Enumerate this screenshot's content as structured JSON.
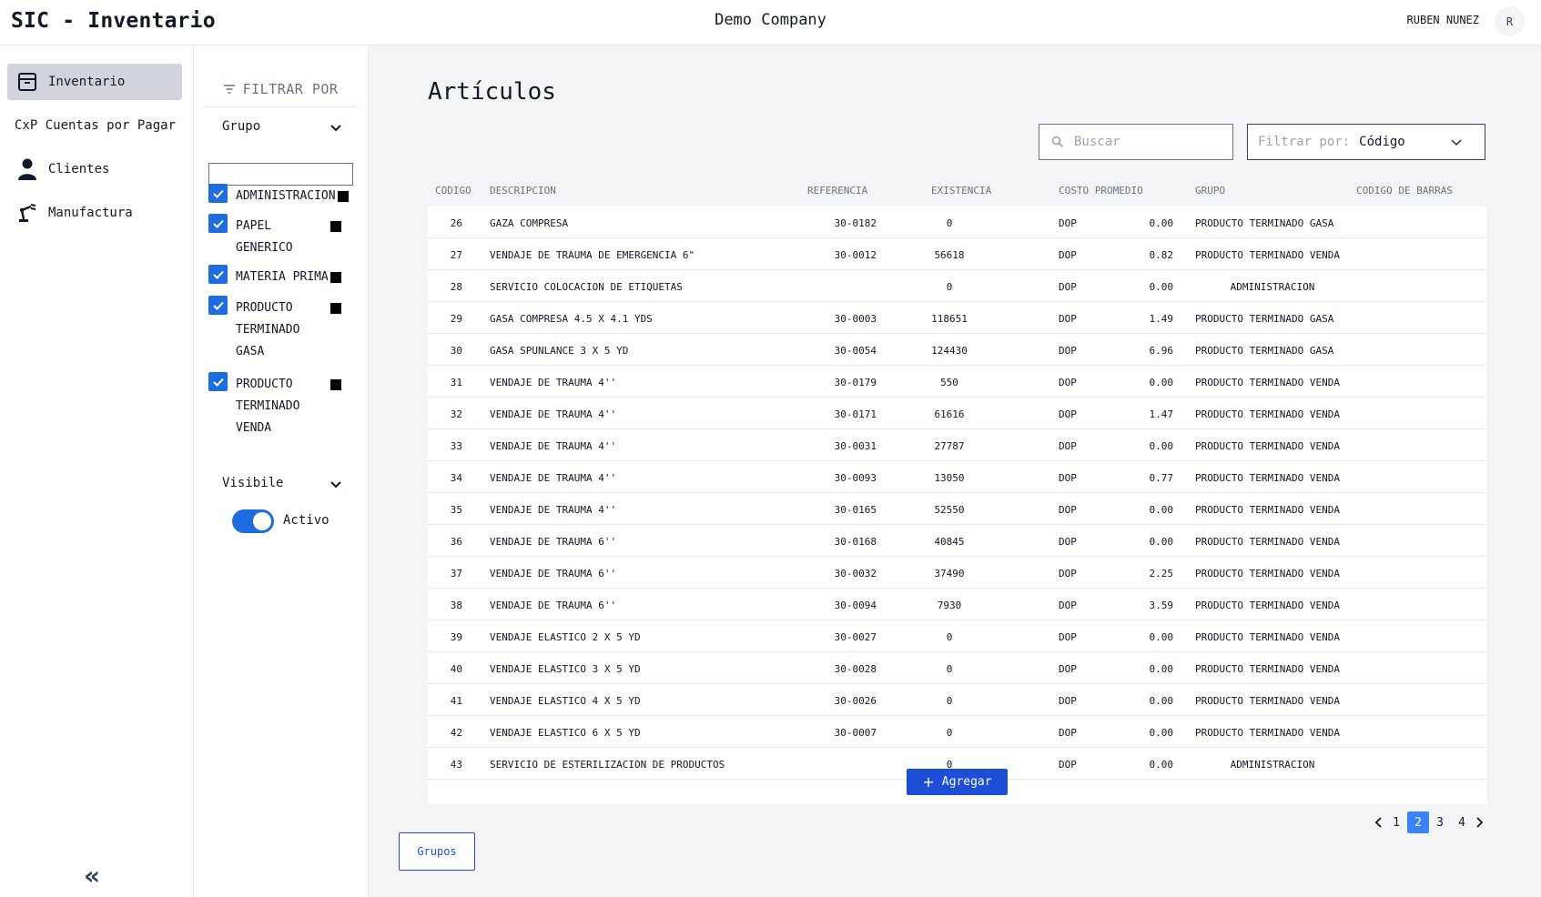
{
  "header": {
    "app_title": "SIC - Inventario",
    "company": "Demo Company",
    "user_name": "RUBEN NUNEZ",
    "avatar_initial": "R"
  },
  "sidebar": {
    "items": [
      {
        "label": "Inventario",
        "icon": "archive-box-icon",
        "active": true
      },
      {
        "label": "CxP Cuentas por Pagar",
        "icon": "",
        "active": false
      },
      {
        "label": "Clientes",
        "icon": "user-icon",
        "active": false
      },
      {
        "label": "Manufactura",
        "icon": "robot-arm-icon",
        "active": false
      }
    ],
    "collapse_glyph": "«"
  },
  "filters": {
    "heading": "FILTRAR POR",
    "group_section": "Grupo",
    "group_search_value": "",
    "groups": [
      {
        "label_lines": [
          "ADMINISTRACION"
        ],
        "checked": true
      },
      {
        "label_lines": [
          "PAPEL",
          "GENERICO"
        ],
        "checked": true
      },
      {
        "label_lines": [
          "MATERIA PRIMA"
        ],
        "checked": true
      },
      {
        "label_lines": [
          "PRODUCTO",
          "TERMINADO",
          "GASA"
        ],
        "checked": true
      },
      {
        "label_lines": [
          "PRODUCTO",
          "TERMINADO",
          "VENDA"
        ],
        "checked": true
      }
    ],
    "visible_section": "Visibile",
    "toggle_label": "Activo",
    "toggle_on": true
  },
  "main": {
    "title": "Artículos",
    "search_placeholder": "Buscar",
    "search_value": "",
    "filter_label": "Filtrar por:",
    "filter_value": "Código",
    "add_button": "Agregar",
    "groups_button": "Grupos",
    "pagination": {
      "pages": [
        "1",
        "2",
        "3",
        "4"
      ],
      "current": "2"
    }
  },
  "table": {
    "columns": [
      "CODIGO",
      "DESCRIPCION",
      "REFERENCIA",
      "EXISTENCIA",
      "COSTO PROMEDIO",
      "GRUPO",
      "CODIGO DE BARRAS"
    ],
    "rows": [
      {
        "codigo": "26",
        "descripcion": "GAZA COMPRESA",
        "referencia": "30-0182",
        "existencia": "0",
        "moneda": "DOP",
        "costo": "0.00",
        "grupo": "PRODUCTO TERMINADO GASA",
        "barras": ""
      },
      {
        "codigo": "27",
        "descripcion": "VENDAJE DE TRAUMA DE EMERGENCIA 6\"",
        "referencia": "30-0012",
        "existencia": "56618",
        "moneda": "DOP",
        "costo": "0.82",
        "grupo": "PRODUCTO TERMINADO VENDA",
        "barras": ""
      },
      {
        "codigo": "28",
        "descripcion": "SERVICIO COLOCACION DE ETIQUETAS",
        "referencia": "",
        "existencia": "0",
        "moneda": "DOP",
        "costo": "0.00",
        "grupo": "ADMINISTRACION",
        "barras": ""
      },
      {
        "codigo": "29",
        "descripcion": "GASA COMPRESA 4.5 X 4.1 YDS",
        "referencia": "30-0003",
        "existencia": "118651",
        "moneda": "DOP",
        "costo": "1.49",
        "grupo": "PRODUCTO TERMINADO GASA",
        "barras": ""
      },
      {
        "codigo": "30",
        "descripcion": "GASA SPUNLANCE 3 X 5 YD",
        "referencia": "30-0054",
        "existencia": "124430",
        "moneda": "DOP",
        "costo": "6.96",
        "grupo": "PRODUCTO TERMINADO GASA",
        "barras": ""
      },
      {
        "codigo": "31",
        "descripcion": "VENDAJE DE TRAUMA 4''",
        "referencia": "30-0179",
        "existencia": "550",
        "moneda": "DOP",
        "costo": "0.00",
        "grupo": "PRODUCTO TERMINADO VENDA",
        "barras": ""
      },
      {
        "codigo": "32",
        "descripcion": "VENDAJE DE TRAUMA 4''",
        "referencia": "30-0171",
        "existencia": "61616",
        "moneda": "DOP",
        "costo": "1.47",
        "grupo": "PRODUCTO TERMINADO VENDA",
        "barras": ""
      },
      {
        "codigo": "33",
        "descripcion": "VENDAJE DE TRAUMA 4''",
        "referencia": "30-0031",
        "existencia": "27787",
        "moneda": "DOP",
        "costo": "0.00",
        "grupo": "PRODUCTO TERMINADO VENDA",
        "barras": ""
      },
      {
        "codigo": "34",
        "descripcion": "VENDAJE DE TRAUMA 4''",
        "referencia": "30-0093",
        "existencia": "13050",
        "moneda": "DOP",
        "costo": "0.77",
        "grupo": "PRODUCTO TERMINADO VENDA",
        "barras": ""
      },
      {
        "codigo": "35",
        "descripcion": "VENDAJE DE TRAUMA 4''",
        "referencia": "30-0165",
        "existencia": "52550",
        "moneda": "DOP",
        "costo": "0.00",
        "grupo": "PRODUCTO TERMINADO VENDA",
        "barras": ""
      },
      {
        "codigo": "36",
        "descripcion": "VENDAJE DE TRAUMA 6''",
        "referencia": "30-0168",
        "existencia": "40845",
        "moneda": "DOP",
        "costo": "0.00",
        "grupo": "PRODUCTO TERMINADO VENDA",
        "barras": ""
      },
      {
        "codigo": "37",
        "descripcion": "VENDAJE DE TRAUMA 6''",
        "referencia": "30-0032",
        "existencia": "37490",
        "moneda": "DOP",
        "costo": "2.25",
        "grupo": "PRODUCTO TERMINADO VENDA",
        "barras": ""
      },
      {
        "codigo": "38",
        "descripcion": "VENDAJE DE TRAUMA 6''",
        "referencia": "30-0094",
        "existencia": "7930",
        "moneda": "DOP",
        "costo": "3.59",
        "grupo": "PRODUCTO TERMINADO VENDA",
        "barras": ""
      },
      {
        "codigo": "39",
        "descripcion": "VENDAJE ELASTICO 2 X 5 YD",
        "referencia": "30-0027",
        "existencia": "0",
        "moneda": "DOP",
        "costo": "0.00",
        "grupo": "PRODUCTO TERMINADO VENDA",
        "barras": ""
      },
      {
        "codigo": "40",
        "descripcion": "VENDAJE ELASTICO 3 X 5 YD",
        "referencia": "30-0028",
        "existencia": "0",
        "moneda": "DOP",
        "costo": "0.00",
        "grupo": "PRODUCTO TERMINADO VENDA",
        "barras": ""
      },
      {
        "codigo": "41",
        "descripcion": "VENDAJE ELASTICO 4 X 5 YD",
        "referencia": "30-0026",
        "existencia": "0",
        "moneda": "DOP",
        "costo": "0.00",
        "grupo": "PRODUCTO TERMINADO VENDA",
        "barras": ""
      },
      {
        "codigo": "42",
        "descripcion": "VENDAJE ELASTICO 6 X 5 YD",
        "referencia": "30-0007",
        "existencia": "0",
        "moneda": "DOP",
        "costo": "0.00",
        "grupo": "PRODUCTO TERMINADO VENDA",
        "barras": ""
      },
      {
        "codigo": "43",
        "descripcion": "SERVICIO DE ESTERILIZACION DE PRODUCTOS",
        "referencia": "",
        "existencia": "0",
        "moneda": "DOP",
        "costo": "0.00",
        "grupo": "ADMINISTRACION",
        "barras": ""
      }
    ]
  },
  "colors": {
    "accent": "#1d6ce0",
    "button_primary": "#1d4ed8",
    "active_nav_bg": "#d1d5db",
    "main_bg": "#f3f4f6"
  }
}
